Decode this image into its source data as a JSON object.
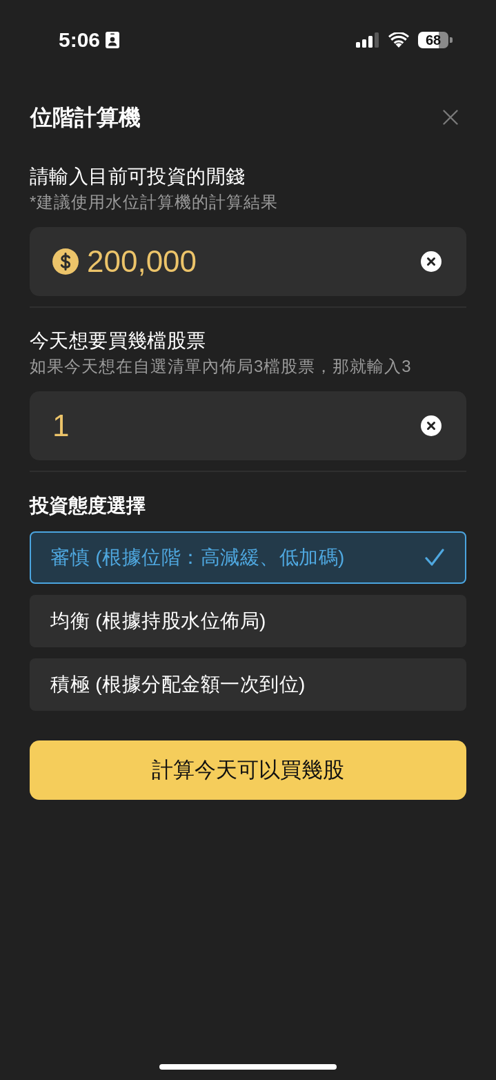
{
  "status_bar": {
    "time": "5:06",
    "battery": "68"
  },
  "header": {
    "title": "位階計算機"
  },
  "fields": [
    {
      "kind": "currency",
      "label": "請輸入目前可投資的閒錢",
      "hint": "*建議使用水位計算機的計算結果",
      "value": "200,000"
    },
    {
      "kind": "number",
      "label": "今天想要買幾檔股票",
      "hint": "如果今天想在自選清單內佈局3檔股票，那就輸入3",
      "value": "1"
    }
  ],
  "attitude": {
    "title": "投資態度選擇",
    "options": [
      {
        "label": "審慎 (根據位階：高減緩、低加碼)",
        "selected": true
      },
      {
        "label": "均衡 (根據持股水位佈局)",
        "selected": false
      },
      {
        "label": "積極 (根據分配金額一次到位)",
        "selected": false
      }
    ]
  },
  "submit_button": {
    "label": "計算今天可以買幾股"
  }
}
